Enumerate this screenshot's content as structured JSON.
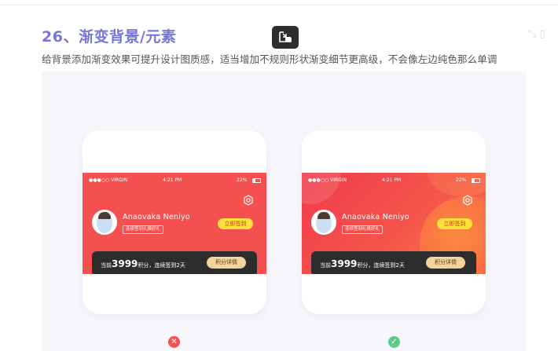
{
  "heading": {
    "title": "26、渐变背景/元素",
    "subtitle": "给背景添加渐变效果可提升设计图质感，适当增加不规则形状渐变细节更高级，不会像左边纯色那么单调"
  },
  "overlay": {
    "pip_icon": "picture-in-picture-icon",
    "corner_icon": "fullscreen-icon"
  },
  "mockups": [
    {
      "variant": "flat",
      "status_bar": {
        "carrier": "●●●○○ VIRGIN",
        "time": "4:21 PM",
        "battery": "22%"
      },
      "profile": {
        "name": "Anaovaka Neniyo",
        "tag": "连续签到礼换好礼",
        "checkin_button": "立即签到"
      },
      "points": {
        "prefix": "当前",
        "value": "3999",
        "suffix": "积分，连续签到2天",
        "button": "积分详情"
      },
      "verdict": "✕",
      "accent": "#f55050"
    },
    {
      "variant": "gradient",
      "status_bar": {
        "carrier": "●●●○○ VIRGIN",
        "time": "4:21 PM",
        "battery": "22%"
      },
      "profile": {
        "name": "Anaovaka Neniyo",
        "tag": "连续签到礼换好礼",
        "checkin_button": "立即签到"
      },
      "points": {
        "prefix": "当前",
        "value": "3999",
        "suffix": "积分，连续签到2天",
        "button": "积分详情"
      },
      "verdict": "✓",
      "accent": "#f87748"
    }
  ]
}
